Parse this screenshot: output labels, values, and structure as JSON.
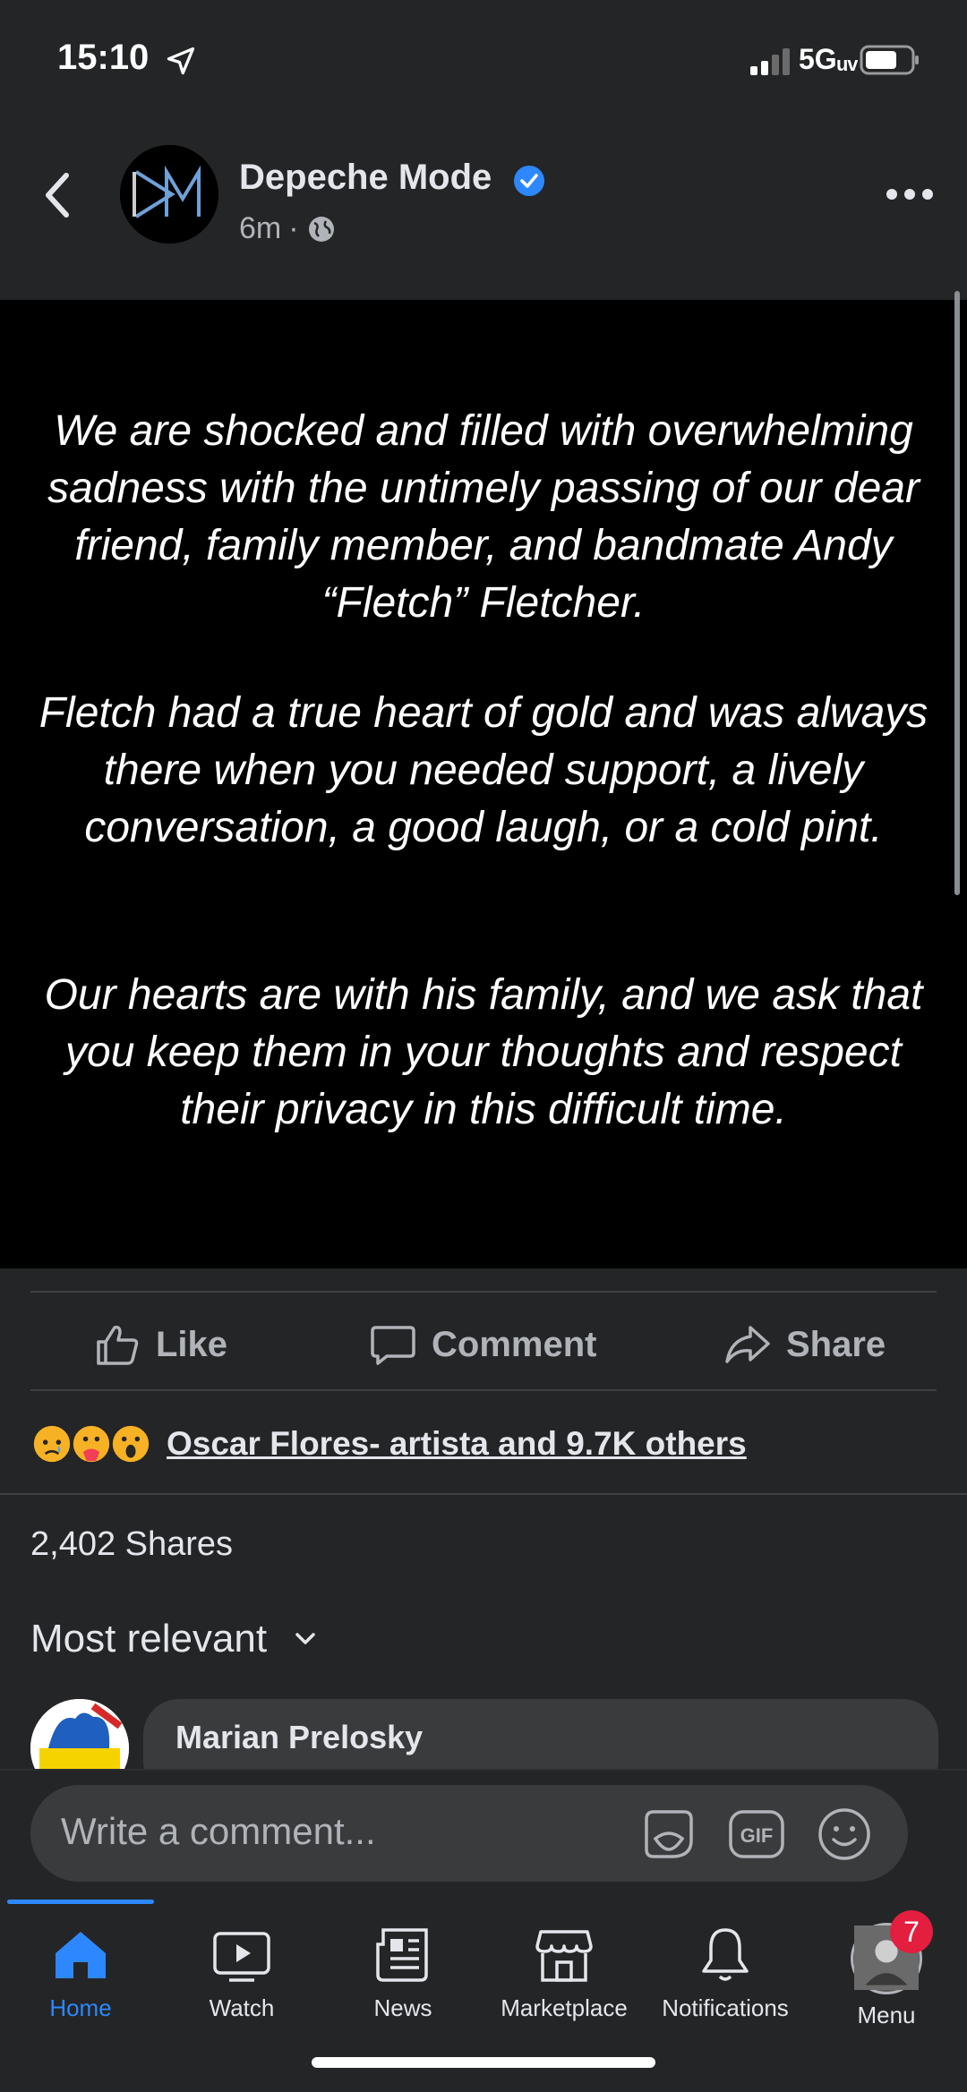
{
  "status_bar": {
    "time": "15:10",
    "network": "5Gᵤᵥ"
  },
  "post": {
    "page_name": "Depeche Mode",
    "avatar_text": "DM",
    "time_ago": "6m",
    "dot": "·",
    "image_paragraphs": [
      "We are shocked and filled with overwhelming sadness with the untimely passing of our dear friend, family member, and bandmate Andy “Fletch” Fletcher.",
      "Fletch had a true heart of gold and was always there when you needed support, a lively conversation, a good laugh, or a cold pint.",
      "Our hearts are with his family, and we ask that you keep them in your thoughts and respect their privacy in this difficult time."
    ]
  },
  "actions": {
    "like": "Like",
    "comment": "Comment",
    "share": "Share"
  },
  "reactions": {
    "summary": "Oscar Flores- artista and 9.7K others",
    "icons": [
      "sad",
      "care",
      "wow"
    ]
  },
  "shares": "2,402 Shares",
  "sort_label": "Most relevant",
  "comment_preview": {
    "author": "Marian Prelosky"
  },
  "composer": {
    "placeholder": "Write a comment...",
    "gif_label": "GIF"
  },
  "tabs": [
    {
      "label": "Home"
    },
    {
      "label": "Watch"
    },
    {
      "label": "News"
    },
    {
      "label": "Marketplace"
    },
    {
      "label": "Notifications"
    },
    {
      "label": "Menu"
    }
  ],
  "notification_badge": "7",
  "colors": {
    "accent": "#2d88ff",
    "background": "#242526",
    "badge": "#e41e3f"
  }
}
